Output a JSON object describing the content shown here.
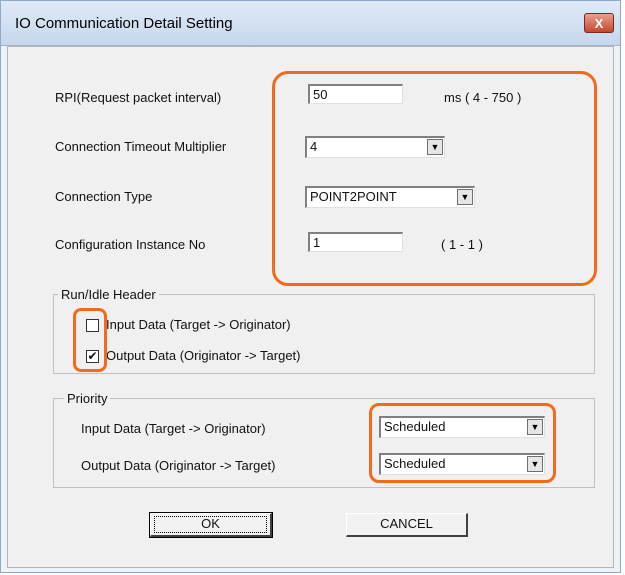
{
  "window": {
    "title": "IO Communication Detail Setting",
    "close_label": "X"
  },
  "fields": {
    "rpi": {
      "label": "RPI(Request packet interval)",
      "value": "50",
      "unit": "ms ( 4 - 750 )"
    },
    "timeout": {
      "label": "Connection Timeout Multiplier",
      "value": "4"
    },
    "conn_type": {
      "label": "Connection Type",
      "value": "POINT2POINT"
    },
    "config_instance": {
      "label": "Configuration Instance No",
      "value": "1",
      "range": "( 1 - 1 )"
    }
  },
  "run_idle": {
    "title": "Run/Idle Header",
    "input_label": "Input Data (Target -> Originator)",
    "input_checked": false,
    "output_label": "Output Data (Originator -> Target)",
    "output_checked": true,
    "check_mark": "✔"
  },
  "priority": {
    "title": "Priority",
    "input_label": "Input Data (Target -> Originator)",
    "input_value": "Scheduled",
    "output_label": "Output Data (Originator -> Target)",
    "output_value": "Scheduled"
  },
  "buttons": {
    "ok": "OK",
    "cancel": "CANCEL"
  },
  "icons": {
    "dropdown": "▼"
  },
  "colors": {
    "highlight": "#f26a1b"
  }
}
